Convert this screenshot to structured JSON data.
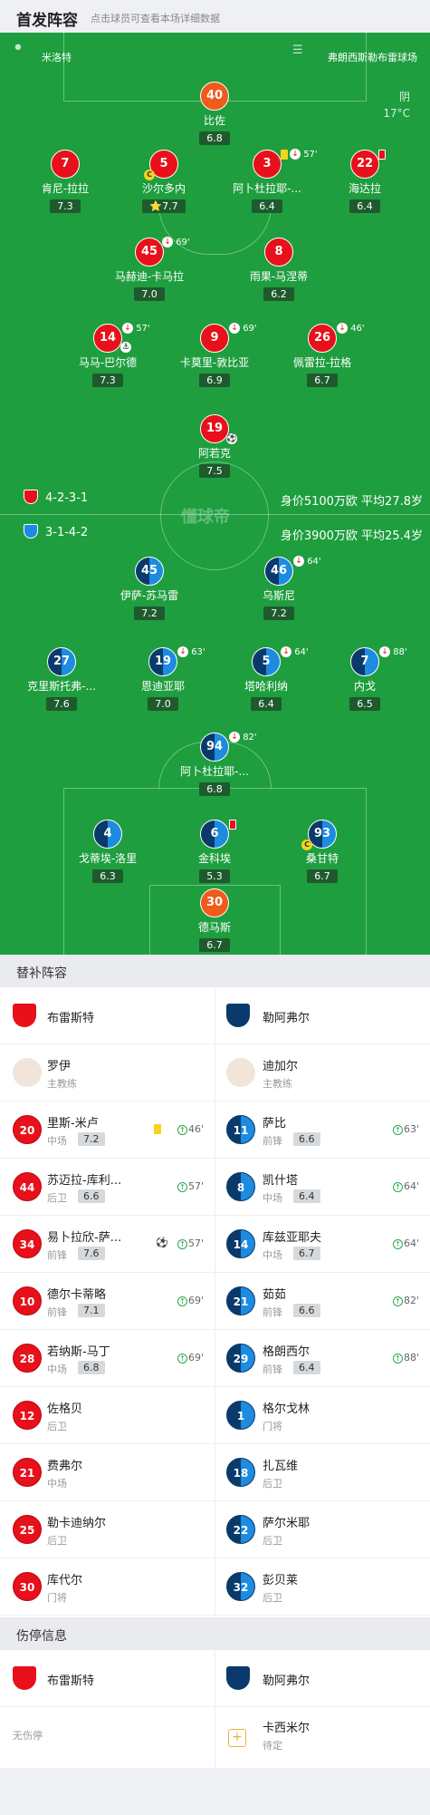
{
  "header": {
    "title": "首发阵容",
    "subtitle": "点击球员可查看本场详细数据"
  },
  "pitch": {
    "referee": "米洛特",
    "stadium": "弗朗西斯勒布雷球场",
    "weather": "阴",
    "temperature": "17°C",
    "watermark": "懂球帝"
  },
  "home": {
    "formation": "4-2-3-1",
    "value_info": "身价5100万欧 平均27.8岁",
    "color": "#e8101a",
    "players": [
      {
        "num": "40",
        "name": "比佐",
        "rating": "6.8",
        "cls": "orange"
      },
      {
        "num": "7",
        "name": "肯尼-拉拉",
        "rating": "7.3",
        "cls": "red"
      },
      {
        "num": "5",
        "name": "沙尔多内",
        "rating": "7.7",
        "cls": "red",
        "star": "⭐"
      },
      {
        "num": "3",
        "name": "阿卜杜拉耶-...",
        "rating": "6.4",
        "cls": "red",
        "evt": "57'"
      },
      {
        "num": "22",
        "name": "海达拉",
        "rating": "6.4",
        "cls": "red"
      },
      {
        "num": "45",
        "name": "马赫迪-卡马拉",
        "rating": "7.0",
        "cls": "red",
        "evt": "69'"
      },
      {
        "num": "8",
        "name": "雨果-马涅蒂",
        "rating": "6.2",
        "cls": "red"
      },
      {
        "num": "14",
        "name": "马马-巴尔德",
        "rating": "7.3",
        "cls": "red",
        "evt": "57'"
      },
      {
        "num": "9",
        "name": "卡莫里-敦比亚",
        "rating": "6.9",
        "cls": "red",
        "evt": "69'"
      },
      {
        "num": "26",
        "name": "佩雷拉-拉格",
        "rating": "6.7",
        "cls": "red",
        "evt": "46'"
      },
      {
        "num": "19",
        "name": "阿若克",
        "rating": "7.5",
        "cls": "red"
      }
    ]
  },
  "away": {
    "formation": "3-1-4-2",
    "value_info": "身价3900万欧 平均25.4岁",
    "color": "#1c8be0",
    "players": [
      {
        "num": "45",
        "name": "伊萨-苏马雷",
        "rating": "7.2"
      },
      {
        "num": "46",
        "name": "乌斯尼",
        "rating": "7.2",
        "evt": "64'"
      },
      {
        "num": "27",
        "name": "克里斯托弗-...",
        "rating": "7.6"
      },
      {
        "num": "19",
        "name": "恩迪亚耶",
        "rating": "7.0",
        "evt": "63'"
      },
      {
        "num": "5",
        "name": "塔哈利纳",
        "rating": "6.4",
        "evt": "64'"
      },
      {
        "num": "7",
        "name": "内戈",
        "rating": "6.5",
        "evt": "88'"
      },
      {
        "num": "94",
        "name": "阿卜杜拉耶-...",
        "rating": "6.8",
        "evt": "82'"
      },
      {
        "num": "4",
        "name": "戈蒂埃-洛里",
        "rating": "6.3"
      },
      {
        "num": "6",
        "name": "金科埃",
        "rating": "5.3"
      },
      {
        "num": "93",
        "name": "桑甘特",
        "rating": "6.7"
      },
      {
        "num": "30",
        "name": "德马斯",
        "rating": "6.7"
      }
    ]
  },
  "subs_section": {
    "title": "替补阵容"
  },
  "subs": {
    "home_team": "布雷斯特",
    "away_team": "勒阿弗尔",
    "home_coach": {
      "name": "罗伊",
      "role": "主教练"
    },
    "away_coach": {
      "name": "迪加尔",
      "role": "主教练"
    },
    "home": [
      {
        "num": "20",
        "name": "里斯-米卢",
        "pos": "中场",
        "rating": "7.2",
        "time": "46'"
      },
      {
        "num": "44",
        "name": "苏迈拉-库利...",
        "pos": "后卫",
        "rating": "6.6",
        "time": "57'"
      },
      {
        "num": "34",
        "name": "易卜拉欣-萨...",
        "pos": "前锋",
        "rating": "7.6",
        "time": "57'"
      },
      {
        "num": "10",
        "name": "德尔卡蒂略",
        "pos": "前锋",
        "rating": "7.1",
        "time": "69'"
      },
      {
        "num": "28",
        "name": "若纳斯-马丁",
        "pos": "中场",
        "rating": "6.8",
        "time": "69'"
      },
      {
        "num": "12",
        "name": "佐格贝",
        "pos": "后卫"
      },
      {
        "num": "21",
        "name": "费弗尔",
        "pos": "中场"
      },
      {
        "num": "25",
        "name": "勒卡迪纳尔",
        "pos": "后卫"
      },
      {
        "num": "30",
        "name": "库代尔",
        "pos": "门将"
      }
    ],
    "away": [
      {
        "num": "11",
        "name": "萨比",
        "pos": "前锋",
        "rating": "6.6",
        "time": "63'"
      },
      {
        "num": "8",
        "name": "凯什塔",
        "pos": "中场",
        "rating": "6.4",
        "time": "64'"
      },
      {
        "num": "14",
        "name": "库兹亚耶夫",
        "pos": "中场",
        "rating": "6.7",
        "time": "64'"
      },
      {
        "num": "21",
        "name": "茹茹",
        "pos": "前锋",
        "rating": "6.6",
        "time": "82'"
      },
      {
        "num": "29",
        "name": "格朗西尔",
        "pos": "前锋",
        "rating": "6.4",
        "time": "88'"
      },
      {
        "num": "1",
        "name": "格尔戈林",
        "pos": "门将"
      },
      {
        "num": "18",
        "name": "扎瓦维",
        "pos": "后卫"
      },
      {
        "num": "22",
        "name": "萨尔米耶",
        "pos": "后卫"
      },
      {
        "num": "32",
        "name": "彭贝莱",
        "pos": "后卫"
      }
    ]
  },
  "injury": {
    "title": "伤停信息",
    "home_team": "布雷斯特",
    "away_team": "勒阿弗尔",
    "home_none": "无伤停",
    "away_player": "卡西米尔",
    "away_status": "待定"
  }
}
